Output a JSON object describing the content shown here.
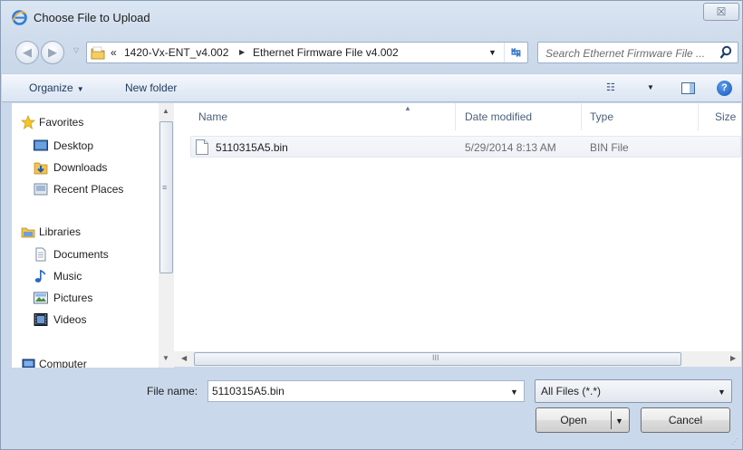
{
  "window": {
    "title": "Choose File to Upload",
    "close_glyph": "☒",
    "title_icon": "internet-explorer-icon"
  },
  "address": {
    "overflow": "«",
    "crumbs": [
      "1420-Vx-ENT_v4.002",
      "Ethernet Firmware File v4.002"
    ],
    "separator": "▶",
    "dropdown": "▼",
    "refresh": "↹"
  },
  "search": {
    "placeholder": "Search Ethernet Firmware File ..."
  },
  "toolbar": {
    "organize_label": "Organize",
    "organize_arrow": "▼",
    "new_folder_label": "New folder",
    "views_glyph": "☷",
    "views_arrow": "▼",
    "help_glyph": "?"
  },
  "sidebar": {
    "items": [
      {
        "label": "Favorites",
        "icon": "star-icon"
      },
      {
        "label": "Desktop",
        "icon": "desktop-icon"
      },
      {
        "label": "Downloads",
        "icon": "downloads-icon"
      },
      {
        "label": "Recent Places",
        "icon": "recent-places-icon"
      },
      {
        "label": "Libraries",
        "icon": "libraries-icon"
      },
      {
        "label": "Documents",
        "icon": "documents-icon"
      },
      {
        "label": "Music",
        "icon": "music-icon"
      },
      {
        "label": "Pictures",
        "icon": "pictures-icon"
      },
      {
        "label": "Videos",
        "icon": "videos-icon"
      },
      {
        "label": "Computer",
        "icon": "computer-icon"
      }
    ],
    "scroll_up": "▲",
    "scroll_down": "▼",
    "grip": "≡"
  },
  "file_list": {
    "columns": [
      "Name",
      "Date modified",
      "Type",
      "Size"
    ],
    "sort_indicator": "▲",
    "rows": [
      {
        "name": "5110315A5.bin",
        "date": "5/29/2014 8:13 AM",
        "type": "BIN File"
      }
    ],
    "hscroll_left": "◀",
    "hscroll_right": "▶",
    "hscroll_grip": "III"
  },
  "footer": {
    "file_name_label": "File name:",
    "file_name_value": "5110315A5.bin",
    "file_name_dropdown": "▼",
    "filter_value": "All Files (*.*)",
    "filter_dropdown": "▼",
    "open_label": "Open",
    "open_arrow": "▼",
    "cancel_label": "Cancel"
  },
  "colors": {
    "chrome": "#cfdcec",
    "link_text": "#1e395b",
    "pane_background": "#ffffff"
  }
}
